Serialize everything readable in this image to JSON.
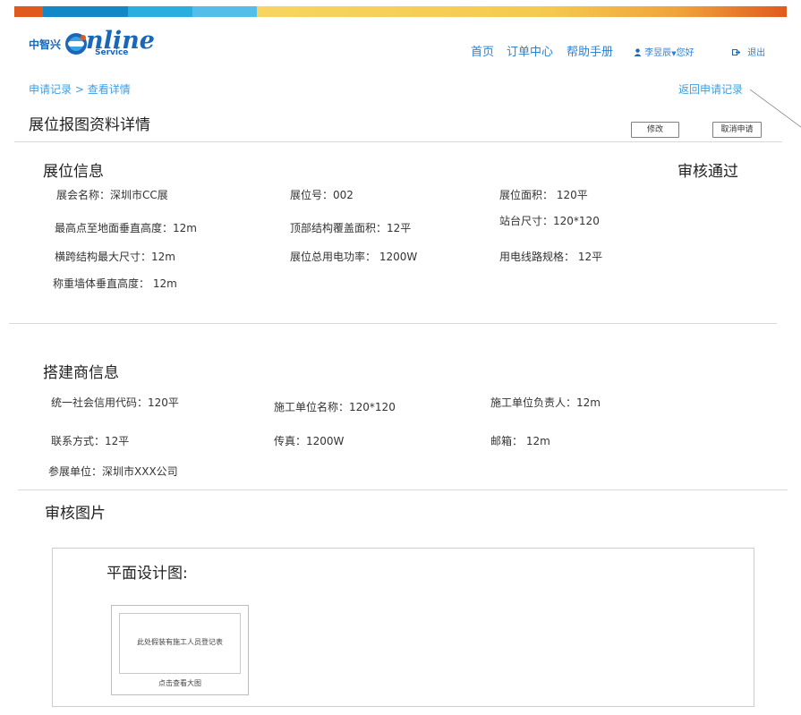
{
  "brand": {
    "name_cn": "中智兴",
    "logo_letter": "O",
    "logo_text": "nline",
    "logo_sub": "Service",
    "colors": {
      "primary": "#1a67b7",
      "link": "#3a9ee4",
      "strip_orange": "#e05a1e",
      "strip_blue_dark": "#1388c7",
      "strip_blue_light": "#55bdea",
      "strip_yellow": "#f7d15c"
    }
  },
  "nav": {
    "items": [
      "首页",
      "订单中心",
      "帮助手册"
    ],
    "user": "李昱辰",
    "greeting": "您好",
    "logout": "退出"
  },
  "breadcrumb": {
    "parent": "申请记录",
    "sep": ">",
    "current": "查看详情"
  },
  "back_link": "返回申请记录",
  "page_title": "展位报图资料详情",
  "buttons": {
    "edit": "修改",
    "cancel": "取消申请"
  },
  "booth": {
    "section_title": "展位信息",
    "status": "审核通过",
    "fields": [
      {
        "label": "展会名称：",
        "value": "深圳市CC展"
      },
      {
        "label": "展位号：",
        "value": "002"
      },
      {
        "label": "展位面积：",
        "value": " 120平"
      },
      {
        "label": "最高点至地面垂直高度：",
        "value": "12m"
      },
      {
        "label": "顶部结构覆盖面积：",
        "value": "12平"
      },
      {
        "label": "站台尺寸：",
        "value": "120*120"
      },
      {
        "label": "横跨结构最大尺寸：",
        "value": "12m"
      },
      {
        "label": "展位总用电功率：",
        "value": " 1200W"
      },
      {
        "label": "用电线路规格：",
        "value": " 12平"
      },
      {
        "label": "称重墙体垂直高度：",
        "value": " 12m"
      }
    ]
  },
  "builder": {
    "section_title": "搭建商信息",
    "fields": [
      {
        "label": "统一社会信用代码：",
        "value": "120平"
      },
      {
        "label": "施工单位名称：",
        "value": "120*120"
      },
      {
        "label": "施工单位负责人：",
        "value": "12m"
      },
      {
        "label": "联系方式：",
        "value": "12平"
      },
      {
        "label": "传真：",
        "value": "1200W"
      },
      {
        "label": "邮箱：",
        "value": " 12m"
      },
      {
        "label": "参展单位：",
        "value": "深圳市XXX公司"
      }
    ]
  },
  "review": {
    "section_title": "审核图片",
    "plan_title": "平面设计图:",
    "placeholder": "此处假装有施工人员登记表",
    "view_large": "点击查看大图"
  }
}
